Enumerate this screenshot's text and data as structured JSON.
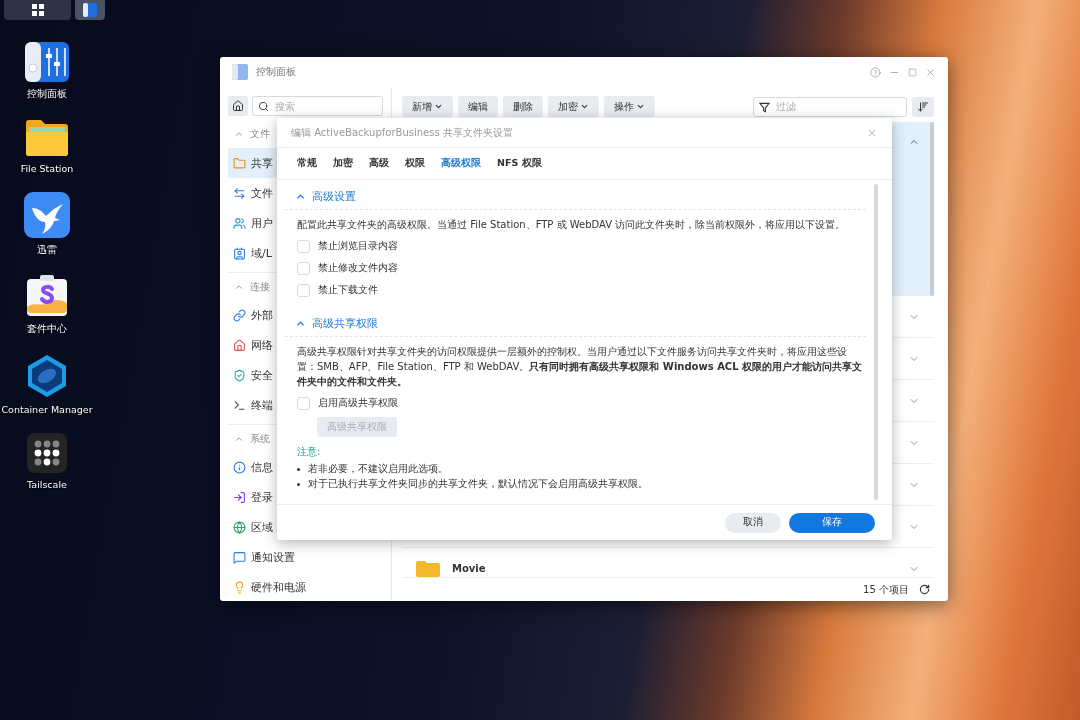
{
  "taskbar": {
    "buttons": [
      {
        "selected": false
      },
      {
        "selected": true
      }
    ]
  },
  "desktop_icons": [
    {
      "label": "控制面板"
    },
    {
      "label": "File Station"
    },
    {
      "label": "迅雷"
    },
    {
      "label": "套件中心"
    },
    {
      "label": "Container Manager"
    },
    {
      "label": "Tailscale"
    }
  ],
  "window": {
    "title": "控制面板",
    "sidebar": {
      "search": {
        "placeholder": "搜索"
      },
      "sections": [
        {
          "header": "文件",
          "expanded": true,
          "items": [
            {
              "label": "共享",
              "selected": true
            },
            {
              "label": "文件",
              "selected": false
            },
            {
              "label": "用户",
              "selected": false
            },
            {
              "label": "域/L",
              "selected": false
            }
          ]
        },
        {
          "header": "连接",
          "expanded": true,
          "items": [
            {
              "label": "外部",
              "selected": false
            },
            {
              "label": "网络",
              "selected": false
            },
            {
              "label": "安全",
              "selected": false
            },
            {
              "label": "终端",
              "selected": false
            }
          ]
        },
        {
          "header": "系统",
          "expanded": true,
          "items": [
            {
              "label": "信息",
              "selected": false
            },
            {
              "label": "登录",
              "selected": false
            },
            {
              "label": "区域",
              "selected": false
            },
            {
              "label": "通知设置",
              "selected": false
            },
            {
              "label": "硬件和电源",
              "selected": false
            }
          ]
        }
      ]
    },
    "toolbar": {
      "buttons": [
        {
          "label": "新增",
          "dropdown": true
        },
        {
          "label": "编辑",
          "dropdown": false
        },
        {
          "label": "删除",
          "dropdown": false
        },
        {
          "label": "加密",
          "dropdown": true
        },
        {
          "label": "操作",
          "dropdown": true
        }
      ],
      "filter": {
        "placeholder": "过滤"
      }
    },
    "rows": [
      {
        "expanded": true
      },
      {
        "expanded": false
      },
      {
        "expanded": false
      },
      {
        "expanded": false
      },
      {
        "expanded": false
      },
      {
        "expanded": false
      },
      {
        "expanded": false
      },
      {
        "name": "Movie",
        "expanded": false
      }
    ],
    "status": "15 个项目"
  },
  "dialog": {
    "title": "编辑 ActiveBackupforBusiness 共享文件夹设置",
    "tabs": [
      {
        "label": "常规",
        "selected": false
      },
      {
        "label": "加密",
        "selected": false
      },
      {
        "label": "高级",
        "selected": false
      },
      {
        "label": "权限",
        "selected": false
      },
      {
        "label": "高级权限",
        "selected": true
      },
      {
        "label": "NFS 权限",
        "selected": false
      }
    ],
    "sections": [
      {
        "title": "高级设置",
        "expanded": true,
        "description": "配置此共享文件夹的高级权限。当通过 File Station、FTP 或 WebDAV 访问此文件夹时，除当前权限外，将应用以下设置。",
        "checkboxes": [
          {
            "label": "禁止浏览目录内容",
            "checked": false
          },
          {
            "label": "禁止修改文件内容",
            "checked": false
          },
          {
            "label": "禁止下载文件",
            "checked": false
          }
        ]
      },
      {
        "title": "高级共享权限",
        "expanded": true,
        "description": "高级共享权限针对共享文件夹的访问权限提供一层额外的控制权。当用户通过以下文件服务访问共享文件夹时，将应用这些设置：SMB、AFP、File Station、FTP 和 WebDAV。**只有同时拥有高级共享权限和 Windows ACL 权限的用户才能访问共享文件夹中的文件和文件夹。**",
        "checkboxes": [
          {
            "label": "启用高级共享权限",
            "checked": false
          }
        ],
        "button": {
          "label": "高级共享权限",
          "disabled": true
        },
        "note_title": "注意:",
        "notes": [
          "若非必要，不建议启用此选项。",
          "对于已执行共享文件夹同步的共享文件夹，默认情况下会启用高级共享权限。"
        ]
      }
    ],
    "buttons": [
      {
        "label": "取消",
        "primary": false
      },
      {
        "label": "保存",
        "primary": true
      }
    ]
  }
}
